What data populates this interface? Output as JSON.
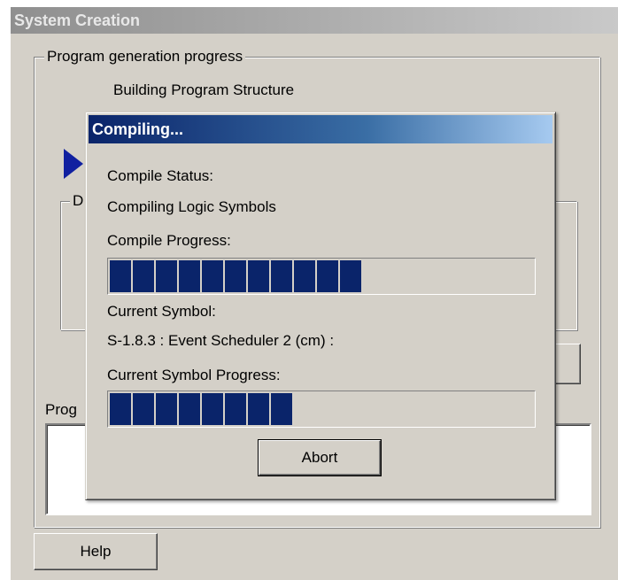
{
  "main_window": {
    "title": "System Creation",
    "group_label": "Program generation progress",
    "step_text": "Building Program Structure",
    "inner_group_label_partial": "D",
    "log_label_partial": "Prog",
    "help_button": "Help",
    "arrow_icon": "blue-arrow-icon"
  },
  "compile_dialog": {
    "title": "Compiling...",
    "compile_status_label": "Compile Status:",
    "compile_status_value": "Compiling Logic Symbols",
    "compile_progress_label": "Compile Progress:",
    "compile_progress_blocks": 11,
    "current_symbol_label": "Current Symbol:",
    "current_symbol_value": "S-1.8.3 : Event Scheduler 2 (cm) :",
    "symbol_progress_label": "Current Symbol Progress:",
    "symbol_progress_blocks": 8,
    "abort_button": "Abort",
    "progress_color": "#0a246a",
    "title_gradient": [
      "#0a246a",
      "#a6caf0"
    ]
  }
}
